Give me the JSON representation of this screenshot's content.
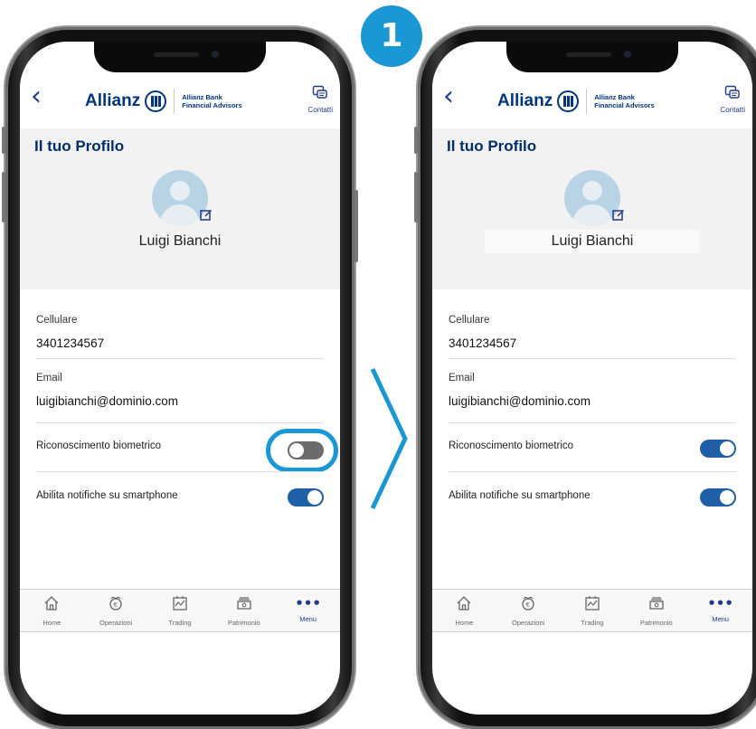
{
  "step": {
    "number": "1"
  },
  "header": {
    "back_glyph": "‹",
    "brand_name": "Allianz",
    "brand_sub_line1": "Allianz Bank",
    "brand_sub_line2": "Financial Advisors",
    "contatti_label": "Contatti"
  },
  "profile": {
    "title": "Il tuo Profilo",
    "user_name": "Luigi Bianchi"
  },
  "fields": {
    "phone_label": "Cellulare",
    "phone_value": "3401234567",
    "email_label": "Email",
    "email_value": "luigibianchi@dominio.com"
  },
  "toggles": {
    "biometric_label": "Riconoscimento biometrico",
    "notifications_label": "Abilita notifiche su smartphone"
  },
  "screens": [
    {
      "name": "before",
      "biometric_enabled": false,
      "notifications_enabled": true
    },
    {
      "name": "after",
      "biometric_enabled": true,
      "notifications_enabled": true
    }
  ],
  "tabbar": {
    "items": [
      {
        "label": "Home",
        "icon": "home-icon"
      },
      {
        "label": "Operazioni",
        "icon": "euro-hand-icon"
      },
      {
        "label": "Trading",
        "icon": "chart-icon"
      },
      {
        "label": "Patrimonio",
        "icon": "cash-icon"
      },
      {
        "label": "Menu",
        "icon": "more-icon"
      }
    ],
    "active": "Menu"
  },
  "colors": {
    "accent": "#1a98d5",
    "brand": "#003781",
    "toggle_on": "#1f5fa8",
    "toggle_off": "#6b6b6b"
  }
}
